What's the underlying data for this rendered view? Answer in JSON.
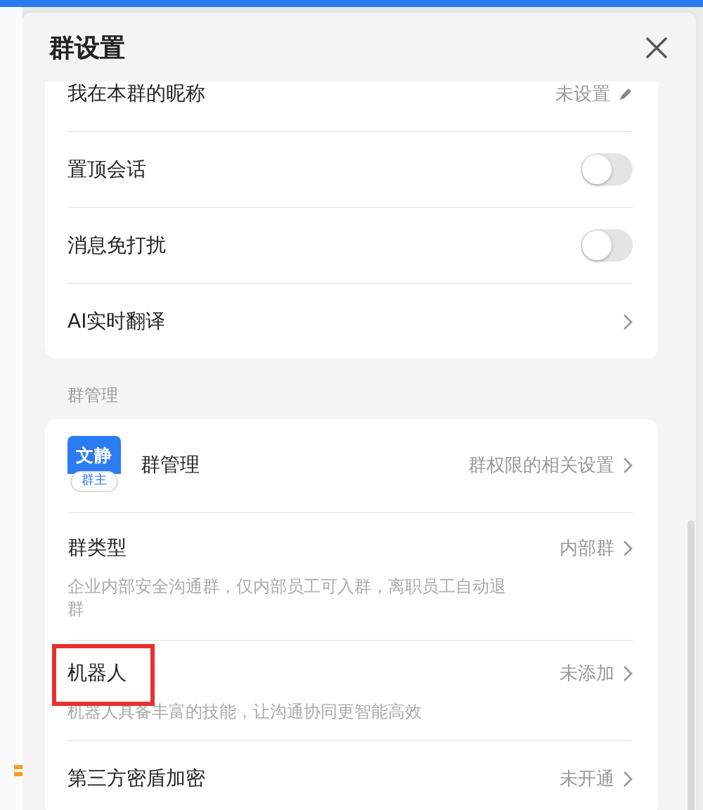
{
  "panel": {
    "title": "群设置",
    "sections": [
      {
        "rows": [
          {
            "kind": "edit",
            "title": "我在本群的昵称",
            "value": "未设置"
          },
          {
            "kind": "switch",
            "title": "置顶会话",
            "on": false
          },
          {
            "kind": "switch",
            "title": "消息免打扰",
            "on": false
          },
          {
            "kind": "link",
            "title": "AI实时翻译"
          }
        ]
      },
      {
        "label": "群管理",
        "rows": [
          {
            "kind": "manage",
            "title": "群管理",
            "value": "群权限的相关设置",
            "avatar": {
              "name": "文静",
              "badge": "群主"
            }
          },
          {
            "kind": "link",
            "title": "群类型",
            "value": "内部群",
            "description": "企业内部安全沟通群，仅内部员工可入群，离职员工自动退群",
            "highlighted": false
          },
          {
            "kind": "link",
            "title": "机器人",
            "value": "未添加",
            "description": "机器人具备丰富的技能，让沟通协同更智能高效",
            "highlighted": true
          },
          {
            "kind": "link",
            "title": "第三方密盾加密",
            "value": "未开通"
          }
        ]
      }
    ]
  }
}
